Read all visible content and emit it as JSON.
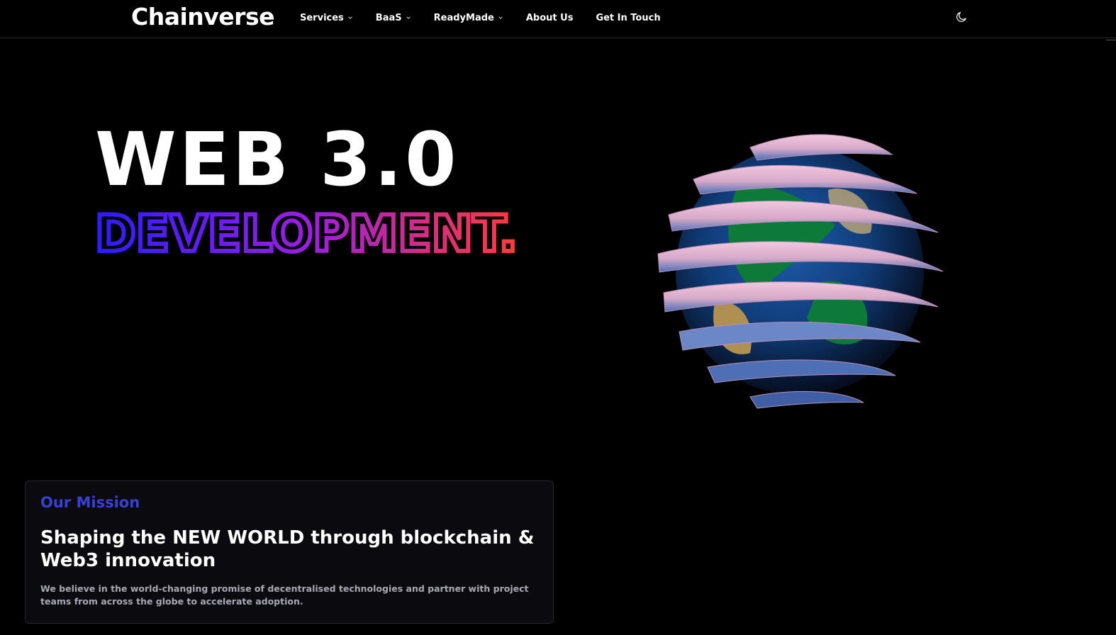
{
  "header": {
    "brand": "Chainverse",
    "nav": [
      {
        "label": "Services",
        "has_dropdown": true
      },
      {
        "label": "BaaS",
        "has_dropdown": true
      },
      {
        "label": "ReadyMade",
        "has_dropdown": true
      },
      {
        "label": "About Us",
        "has_dropdown": false
      },
      {
        "label": "Get In Touch",
        "has_dropdown": false
      }
    ],
    "theme_toggle_icon": "moon-icon"
  },
  "hero": {
    "title": "WEB 3.0",
    "subtitle": "DEVELOPMENT.",
    "subtitle_gradient": [
      "#2a1cff",
      "#8a1ee0",
      "#ff3a3a"
    ],
    "image": "globe-illustration"
  },
  "mission": {
    "label": "Our Mission",
    "heading": "Shaping the NEW WORLD through blockchain & Web3 innovation",
    "body": "We believe in the world-changing promise of decentralised technologies and partner with project teams from across the globe to accelerate adoption."
  },
  "colors": {
    "background": "#000000",
    "accent": "#3a3fd8",
    "card": "#0b0b0f"
  }
}
